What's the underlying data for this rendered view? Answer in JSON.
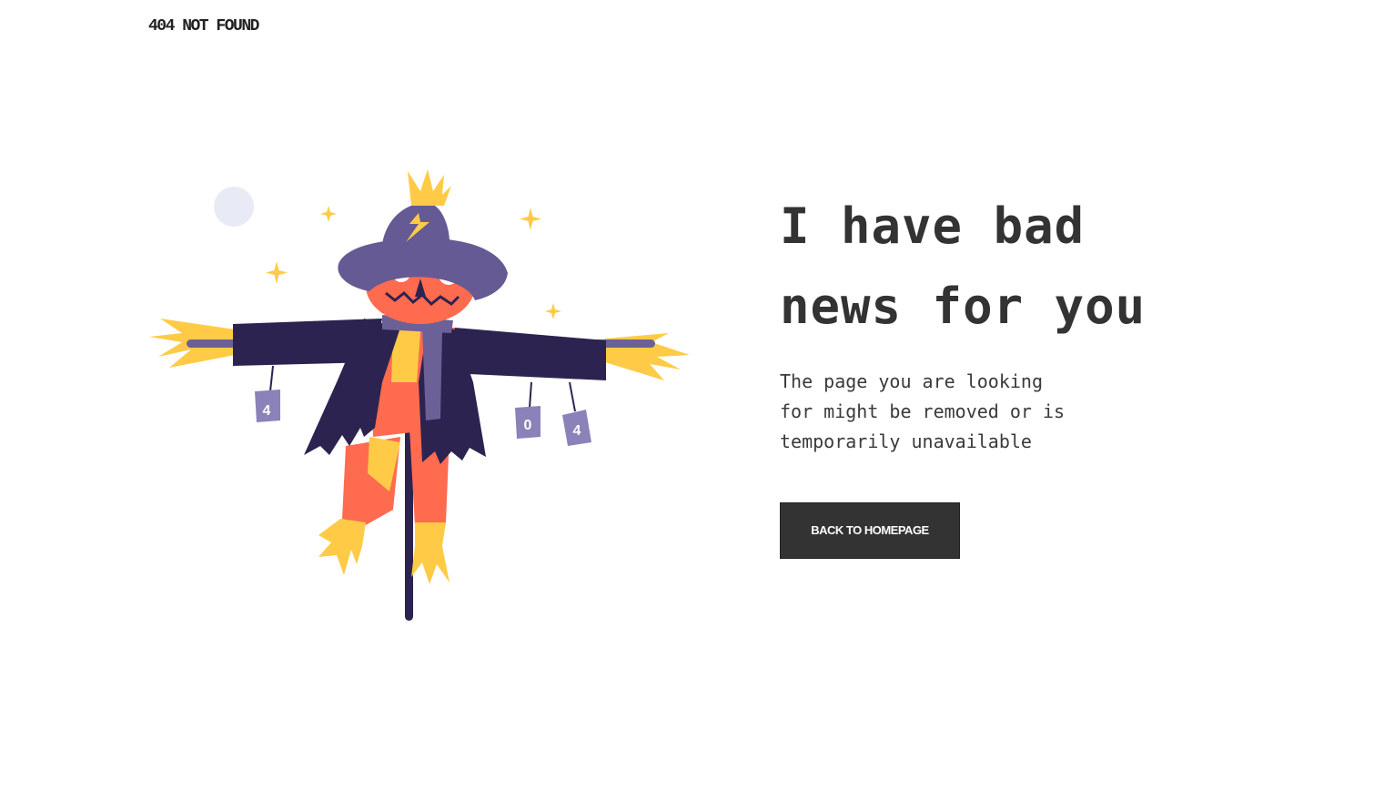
{
  "header": {
    "status_label": "404 NOT FOUND"
  },
  "main": {
    "headline_line1": "I have bad",
    "headline_line2": "news for you",
    "message_line1": "The page you are looking",
    "message_line2": "for might be removed or is",
    "message_line3": "temporarily unavailable",
    "button_label": "BACK TO HOMEPAGE"
  },
  "illustration": {
    "subject": "scarecrow-icon",
    "can_labels": [
      "4",
      "0",
      "4"
    ],
    "colors": {
      "coat": "#2c2350",
      "hat": "#655a93",
      "face": "#ff6b4f",
      "straw": "#ffcb47",
      "moon": "#e8ebf5",
      "can": "#8a82b8"
    }
  },
  "colors": {
    "text": "#333333",
    "button_bg": "#333333",
    "button_text": "#ffffff"
  }
}
